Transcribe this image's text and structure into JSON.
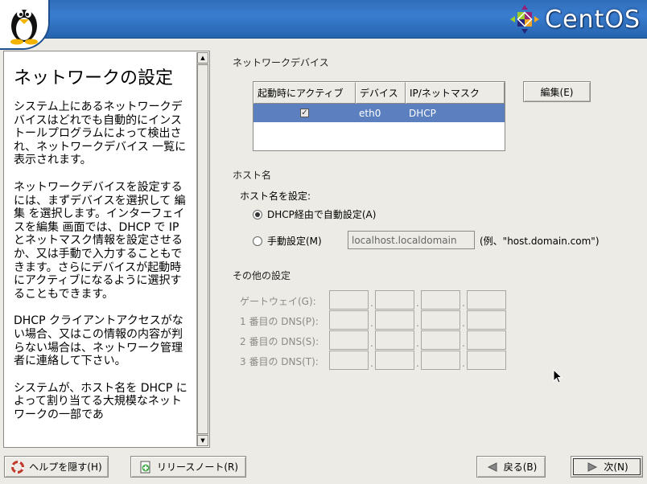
{
  "brand": {
    "name": "CentOS"
  },
  "help": {
    "title": "ネットワークの設定",
    "paragraphs": [
      "システム上にあるネットワークデバイスはどれでも自動的にインストールプログラムによって検出され、ネットワークデバイス 一覧に表示されます。",
      "ネットワークデバイスを設定するには、まずデバイスを選択して 編集 を選択します。インターフェイスを編集 画面では、DHCP で IP とネットマスク情報を設定させるか、又は手動で入力することもできます。さらにデバイスが起動時にアクティブになるように選択することもできます。",
      "DHCP クライアントアクセスがない場合、又はこの情報の内容が判らない場合は、ネットワーク管理者に連絡して下さい。",
      "システムが、ホスト名を DHCP によって割り当てる大規模なネットワークの一部であ"
    ]
  },
  "devices": {
    "section_title": "ネットワークデバイス",
    "columns": [
      "起動時にアクティブ",
      "デバイス",
      "IP/ネットマスク"
    ],
    "rows": [
      {
        "active": true,
        "device": "eth0",
        "ip": "DHCP"
      }
    ],
    "edit_button": "編集(E)"
  },
  "hostname": {
    "section_title": "ホスト名",
    "set_label": "ホスト名を設定:",
    "dhcp_option": "DHCP経由で自動設定(A)",
    "manual_option": "手動設定(M)",
    "selected": "dhcp",
    "manual_value": "localhost.localdomain",
    "example": "(例、\"host.domain.com\")"
  },
  "other": {
    "section_title": "その他の設定",
    "fields": [
      {
        "label": "ゲートウェイ(G):"
      },
      {
        "label": "1 番目の DNS(P):"
      },
      {
        "label": "2 番目の DNS(S):"
      },
      {
        "label": "3 番目の DNS(T):"
      }
    ]
  },
  "footer": {
    "hide_help": "ヘルプを隠す(H)",
    "release_notes": "リリースノート(R)",
    "back": "戻る(B)",
    "next": "次(N)"
  },
  "colors": {
    "header": "#2f6db8",
    "selection": "#5b7fbf",
    "window": "#ecebe6"
  }
}
